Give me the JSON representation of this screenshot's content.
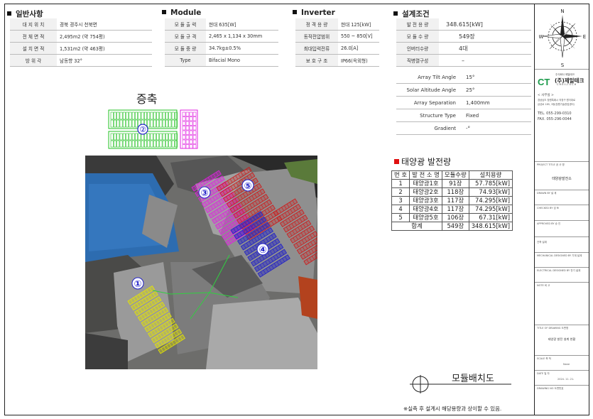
{
  "general": {
    "title": "일반사항",
    "rows": [
      {
        "k": "대 지 위 치",
        "v": "경북 경주시 천북면"
      },
      {
        "k": "전 체 면 적",
        "v": "2,495m2 (약 754평)"
      },
      {
        "k": "설 치 면 적",
        "v": "1,531m2 (약 463평)"
      },
      {
        "k": "방 위 각",
        "v": "남동향 32°"
      }
    ]
  },
  "module": {
    "title": "Module",
    "rows": [
      {
        "k": "모 듈 출 력",
        "v": "현대 635[W]"
      },
      {
        "k": "모 듈 규 격",
        "v": "2,465 x 1,134 x 30mm"
      },
      {
        "k": "모 듈 중 량",
        "v": "34.7kg±0.5%"
      },
      {
        "k": "Type",
        "v": "Bifacial Mono"
      }
    ]
  },
  "inverter": {
    "title": "Inverter",
    "rows": [
      {
        "k": "정 격 용 량",
        "v": "현대 125[kW]"
      },
      {
        "k": "동작전압범위",
        "v": "550 ~ 850[V]"
      },
      {
        "k": "최대입력전류",
        "v": "26.0[A]"
      },
      {
        "k": "보 호 구 조",
        "v": "IP66(옥외형)"
      }
    ]
  },
  "design": {
    "title": "설계조건",
    "rows": [
      {
        "k": "발 전 용 량",
        "v": "348.615[kW]"
      },
      {
        "k": "모 듈 수 량",
        "v": "549장"
      },
      {
        "k": "인버터수량",
        "v": "4대"
      },
      {
        "k": "직병렬구성",
        "v": "–"
      }
    ],
    "conditions": [
      {
        "k": "Array Tilt Angle",
        "v": "15°"
      },
      {
        "k": "Solar Altitude Angle",
        "v": "25°"
      },
      {
        "k": "Array Separation",
        "v": "1,400mm"
      },
      {
        "k": "Structure Type",
        "v": "Fixed"
      },
      {
        "k": "Gradient",
        "v": "-°"
      }
    ]
  },
  "extension": {
    "title": "증축",
    "circle": "②"
  },
  "map": {
    "labels": [
      "①",
      "②",
      "③",
      "④",
      "⑤"
    ]
  },
  "plant": {
    "title": "태양광 발전량",
    "headers": [
      "번 호",
      "발 전 소 명",
      "모듈수량",
      "설치용량"
    ],
    "rows": [
      {
        "no": "1",
        "name": "태양광1호",
        "qty": "91장",
        "cap": "57.785[kW]"
      },
      {
        "no": "2",
        "name": "태양광2호",
        "qty": "118장",
        "cap": "74.93[kW]"
      },
      {
        "no": "3",
        "name": "태양광3호",
        "qty": "117장",
        "cap": "74.295[kW]"
      },
      {
        "no": "4",
        "name": "태양광4호",
        "qty": "117장",
        "cap": "74.295[kW]"
      },
      {
        "no": "5",
        "name": "태양광5호",
        "qty": "106장",
        "cap": "67.31[kW]"
      }
    ],
    "total": {
      "label": "합계",
      "qty": "549장",
      "cap": "348.615[kW]"
    }
  },
  "drawing_title": "모듈배치도",
  "footnote": "※실측 후 설계시 해당용량과 상이할 수 있음.",
  "titleblock": {
    "compass": {
      "n": "N",
      "s": "S",
      "e": "E",
      "w": "W"
    },
    "company_abbr": "CT",
    "company": "(주)제일테크",
    "company_en": "CHEILTECH",
    "company_small": "주식회사 제일테크",
    "office_label": "< 사무실 >",
    "address1": "경상남도 창원특례시 의창구 원이대로",
    "address2": "삼성로 185, 3동(창원기술창업센터)",
    "tel": "TEL. 055-299-0310",
    "fax": "FAX. 055-296-0044",
    "project_label": "PROJECT TITLE 공 사 명",
    "project": "태양광발전소",
    "drawn_label": "DRAWN BY 설 계",
    "checked_label": "CHECKED BY 검 토",
    "approved_label": "APPROVED BY 승 인",
    "arch_label": "건축 설계",
    "mech_label": "MECHANICAL DESIGNED BY 기계 설계",
    "elec_label": "ELECTRICAL DESIGNED BY 전기 설계",
    "note_label": "NOTE 비 고",
    "dwg_label": "TITLE OF DRAWING 도면명",
    "dwg": "태양광 발전 설계 현황",
    "scale_label": "SCALE 축 척",
    "scale": "None",
    "date_label": "DATE 일 자",
    "date": "2024. 11. 21.",
    "dwgno_label": "DRAWING NO 도면번호"
  },
  "colors": {
    "g1": "#e6e600",
    "g2": "#22c022",
    "g3": "#e020e0",
    "g4": "#2020c8",
    "g5": "#d01818"
  }
}
